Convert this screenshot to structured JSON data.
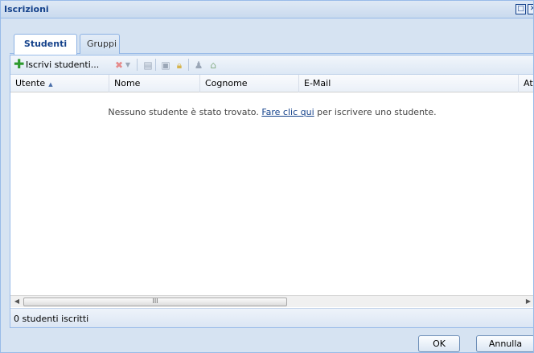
{
  "window": {
    "title": "Iscrizioni"
  },
  "tabs": [
    {
      "label": "Studenti"
    },
    {
      "label": "Gruppi"
    }
  ],
  "toolbar": {
    "add_label": "Iscrivi studenti..."
  },
  "grid": {
    "columns": [
      "Utente",
      "Nome",
      "Cognome",
      "E-Mail",
      "Att"
    ],
    "empty_message": {
      "prefix": "Nessuno studente è stato trovato. ",
      "link": "Fare clic qui",
      "suffix": " per iscrivere uno studente."
    }
  },
  "status": {
    "text": "0 studenti iscritti"
  },
  "buttons": {
    "ok": "OK",
    "cancel": "Annulla"
  }
}
